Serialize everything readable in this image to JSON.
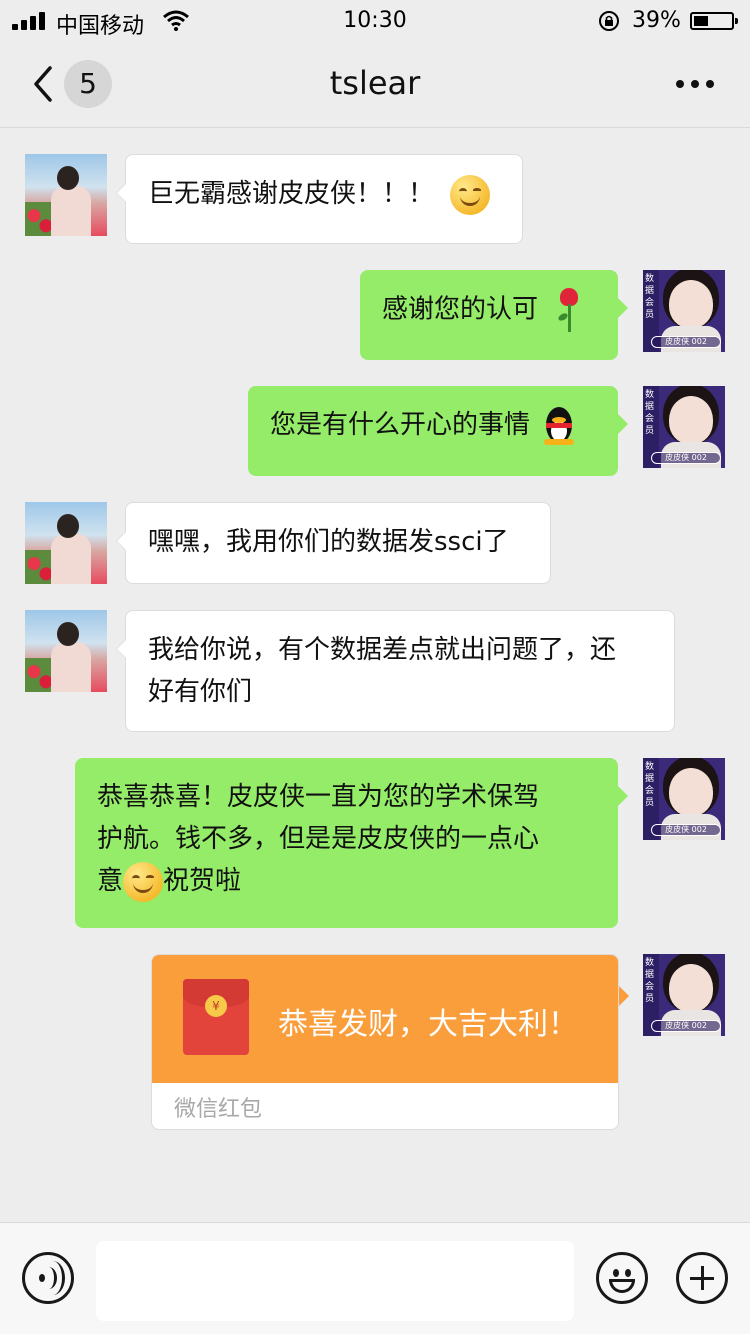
{
  "status_bar": {
    "carrier": "中国移动",
    "time": "10:30",
    "battery_percent": "39%",
    "battery_level": 0.39,
    "icons": [
      "signal-icon",
      "wifi-icon",
      "orientation-lock-icon",
      "battery-icon"
    ]
  },
  "nav": {
    "title": "tslear",
    "unread_count": "5",
    "icons": [
      "back-chevron-icon",
      "more-dots-icon"
    ]
  },
  "avatars": {
    "contact_tag": "皮皮侠 002",
    "contact_side_text": "数据会员"
  },
  "messages": [
    {
      "side": "left",
      "text": "巨无霸感谢皮皮侠！！！",
      "emoji": "smile-emoji"
    },
    {
      "side": "right",
      "text": "感谢您的认可",
      "emoji": "rose-emoji"
    },
    {
      "side": "right",
      "text": "您是有什么开心的事情",
      "emoji": "qq-penguin-emoji"
    },
    {
      "side": "left",
      "text": "嘿嘿，我用你们的数据发ssci了"
    },
    {
      "side": "left",
      "line1": "我给你说，有个数据差点就出问题了，还",
      "line2": "好有你们"
    },
    {
      "side": "right",
      "line1": "恭喜恭喜！皮皮侠一直为您的学术保驾",
      "line2": "护航。钱不多，但是是皮皮侠的一点心",
      "line3_before": "意",
      "line3_after": "祝贺啦",
      "emoji": "smile-emoji"
    }
  ],
  "red_packet": {
    "greeting": "恭喜发财，大吉大利！",
    "footer": "微信红包",
    "coin_symbol": "¥",
    "color": "#fa9d3b"
  },
  "input_bar": {
    "placeholder": "",
    "icons": [
      "voice-icon",
      "emoji-icon",
      "plus-icon"
    ]
  },
  "colors": {
    "background": "#ededed",
    "bubble_self": "#95ec69",
    "bubble_other": "#ffffff"
  }
}
